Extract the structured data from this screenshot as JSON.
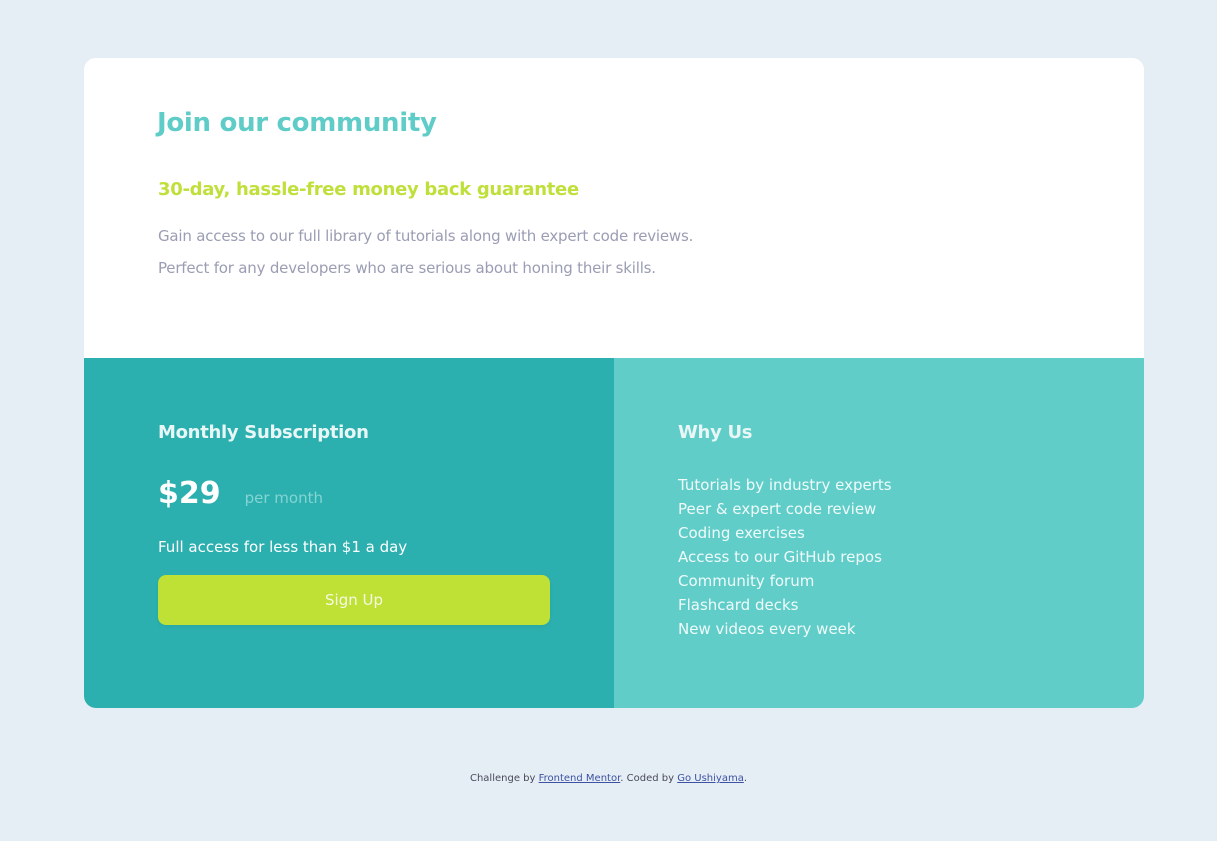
{
  "card": {
    "title": "Join our community",
    "subtitle": "30-day, hassle-free money back guarantee",
    "description_1": "Gain access to our full library of tutorials along with expert code reviews.",
    "description_2": "Perfect for any developers who are serious about honing their skills."
  },
  "subscription": {
    "heading": "Monthly Subscription",
    "price": "$29",
    "period": "per month",
    "tagline": "Full access for less than $1 a day",
    "signup_label": "Sign Up"
  },
  "why_us": {
    "heading": "Why Us",
    "items": [
      "Tutorials by industry experts",
      "Peer & expert code review",
      "Coding exercises",
      "Access to our GitHub repos",
      "Community forum",
      "Flashcard decks",
      "New videos every week"
    ]
  },
  "footer": {
    "prefix": "Challenge by ",
    "link1": "Frontend Mentor",
    "middle": ". Coded by ",
    "link2": "Go Ushiyama",
    "suffix": "."
  },
  "colors": {
    "background": "#e5edf5",
    "teal_dark": "#2bb0af",
    "teal_light": "#60cdc9",
    "lime": "#bfe035",
    "title": "#5fccc8"
  }
}
